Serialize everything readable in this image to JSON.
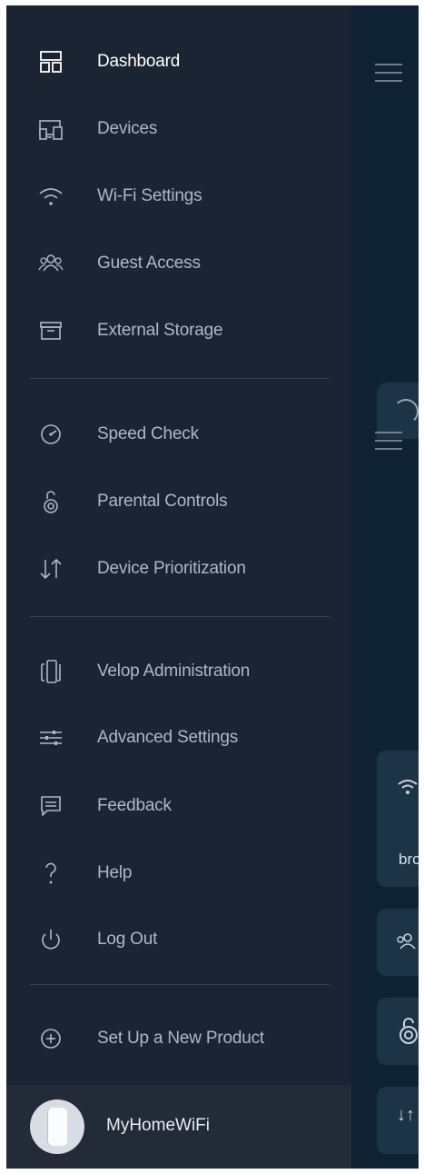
{
  "menu": {
    "group1": [
      {
        "label": "Dashboard",
        "icon": "dashboard-icon",
        "active": true
      },
      {
        "label": "Devices",
        "icon": "devices-icon"
      },
      {
        "label": "Wi-Fi Settings",
        "icon": "wifi-icon"
      },
      {
        "label": "Guest Access",
        "icon": "guest-access-icon"
      },
      {
        "label": "External Storage",
        "icon": "external-storage-icon"
      }
    ],
    "group2": [
      {
        "label": "Speed Check",
        "icon": "speed-check-icon"
      },
      {
        "label": "Parental Controls",
        "icon": "parental-controls-icon"
      },
      {
        "label": "Device Prioritization",
        "icon": "device-prioritization-icon"
      }
    ],
    "group3": [
      {
        "label": "Velop Administration",
        "icon": "velop-administration-icon"
      },
      {
        "label": "Advanced Settings",
        "icon": "advanced-settings-icon"
      },
      {
        "label": "Feedback",
        "icon": "feedback-icon"
      },
      {
        "label": "Help",
        "icon": "help-icon"
      },
      {
        "label": "Log Out",
        "icon": "log-out-icon"
      }
    ],
    "group4": [
      {
        "label": "Set Up a New Product",
        "icon": "add-circle-icon"
      }
    ]
  },
  "footer": {
    "network_name": "MyHomeWiFi",
    "avatar": "velop-node-avatar"
  },
  "background_app": {
    "partial_text": "bro"
  },
  "colors": {
    "drawer_bg": "#1b2432",
    "footer_bg": "#222b37",
    "text_active": "#ffffff",
    "text_muted": "#aeb8c4",
    "background_app": "#0f2233"
  }
}
